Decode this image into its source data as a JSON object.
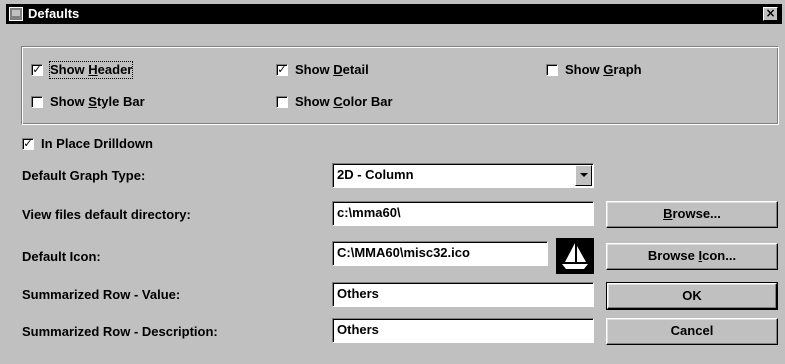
{
  "window": {
    "title": "Defaults",
    "close_glyph": "×"
  },
  "options": {
    "show_header": {
      "pre": "Show ",
      "key": "H",
      "post": "eader",
      "checked": true
    },
    "show_detail": {
      "pre": "Show ",
      "key": "D",
      "post": "etail",
      "checked": true
    },
    "show_graph": {
      "pre": "Show ",
      "key": "G",
      "post": "raph",
      "checked": false
    },
    "show_style_bar": {
      "pre": "Show ",
      "key": "S",
      "post": "tyle Bar",
      "checked": false
    },
    "show_color_bar": {
      "pre": "Show ",
      "key": "C",
      "post": "olor Bar",
      "checked": false
    },
    "in_place_drilldown": {
      "label": "In Place Drilldown",
      "checked": true
    }
  },
  "form": {
    "graph_type_label": "Default Graph Type:",
    "graph_type_value": "2D - Column",
    "dir_label": "View files default directory:",
    "dir_value": "c:\\mma60\\",
    "icon_label": "Default Icon:",
    "icon_value": "C:\\MMA60\\misc32.ico",
    "summ_value_label": "Summarized Row - Value:",
    "summ_value": "Others",
    "summ_desc_label": "Summarized Row - Description:",
    "summ_desc": "Others"
  },
  "buttons": {
    "browse": {
      "key": "B",
      "post": "rowse..."
    },
    "browse_icon": {
      "pre": "Browse ",
      "key": "I",
      "post": "con..."
    },
    "ok": "OK",
    "cancel": "Cancel"
  },
  "icons": {
    "titlebar": "app-icon",
    "preview": "sailboat-icon"
  },
  "colors": {
    "face": "#c0c0c0",
    "titlebar": "#000000",
    "field": "#ffffff"
  }
}
